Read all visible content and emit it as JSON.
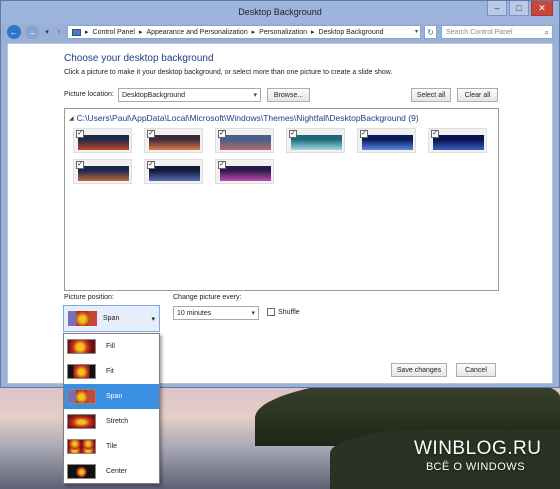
{
  "window": {
    "title": "Desktop Background"
  },
  "titlebar": {
    "minimize": "–",
    "maximize": "□",
    "close": "✕"
  },
  "nav": {
    "back": "←",
    "forward": "→",
    "recent": "▾",
    "up": "↑",
    "breadcrumb": [
      "Control Panel",
      "Appearance and Personalization",
      "Personalization",
      "Desktop Background"
    ],
    "separator": "▸",
    "dropdown_glyph": "▾",
    "refresh": "↻",
    "search_placeholder": "Search Control Panel"
  },
  "main": {
    "heading": "Choose your desktop background",
    "description": "Click a picture to make it your desktop background, or select more than one picture to create a slide show.",
    "picture_location_label": "Picture location:",
    "picture_location_value": "DesktopBackground",
    "browse_label": "Browse...",
    "select_all_label": "Select all",
    "clear_all_label": "Clear all",
    "folder": "C:\\Users\\Paul\\AppData\\Local\\Microsoft\\Windows\\Themes\\Nightfall\\DesktopBackground (9)",
    "picture_position_label": "Picture position:",
    "picture_position_value": "Span",
    "change_every_label": "Change picture every:",
    "change_every_value": "10 minutes",
    "shuffle_label": "Shuffle",
    "save_label": "Save changes",
    "cancel_label": "Cancel"
  },
  "thumbnails": [
    {
      "checked": true,
      "colors": [
        "#1c2a4a",
        "#c0472a"
      ]
    },
    {
      "checked": true,
      "colors": [
        "#3a2a3a",
        "#e07a4a"
      ]
    },
    {
      "checked": true,
      "colors": [
        "#4a5f8a",
        "#b56a6a"
      ]
    },
    {
      "checked": true,
      "colors": [
        "#1a6a7a",
        "#a8d8e0"
      ]
    },
    {
      "checked": true,
      "colors": [
        "#0a1a5a",
        "#5a8ae0"
      ]
    },
    {
      "checked": true,
      "colors": [
        "#0a1050",
        "#3a60c0"
      ]
    },
    {
      "checked": true,
      "colors": [
        "#1a2850",
        "#c06a40"
      ]
    },
    {
      "checked": true,
      "colors": [
        "#101a3a",
        "#5a6ab0"
      ]
    },
    {
      "checked": true,
      "colors": [
        "#2a1a4a",
        "#c04ab0"
      ]
    }
  ],
  "position_options": [
    {
      "label": "Fill",
      "selected": false
    },
    {
      "label": "Fit",
      "selected": false
    },
    {
      "label": "Span",
      "selected": true
    },
    {
      "label": "Stretch",
      "selected": false
    },
    {
      "label": "Tile",
      "selected": false
    },
    {
      "label": "Center",
      "selected": false
    }
  ],
  "watermark": {
    "site": "WINBLOG.RU",
    "tagline": "ВСЁ О WINDOWS"
  }
}
